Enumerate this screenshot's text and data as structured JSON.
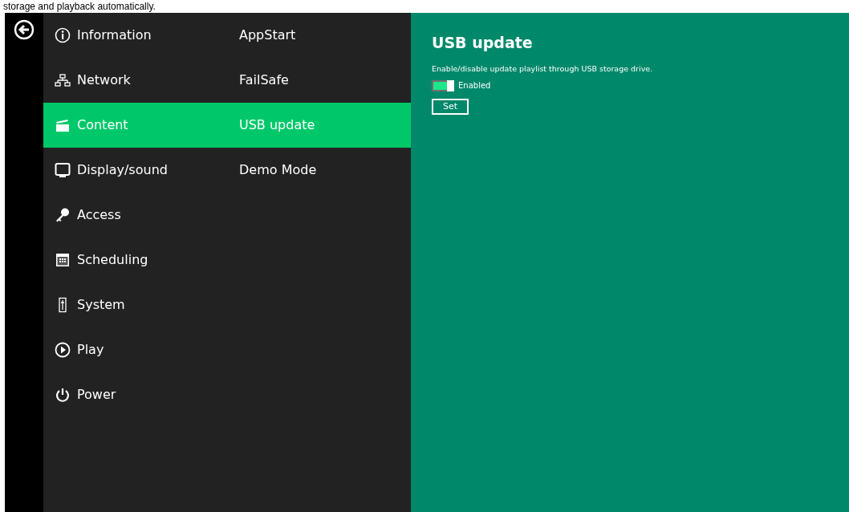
{
  "caption": "storage and playback automatically.",
  "categories": [
    {
      "label": "Information",
      "kind": "info",
      "selected": false
    },
    {
      "label": "Network",
      "kind": "network",
      "selected": false
    },
    {
      "label": "Content",
      "kind": "clapper",
      "selected": true
    },
    {
      "label": "Display/sound",
      "kind": "monitor",
      "selected": false
    },
    {
      "label": "Access",
      "kind": "key",
      "selected": false
    },
    {
      "label": "Scheduling",
      "kind": "calendar",
      "selected": false
    },
    {
      "label": "System",
      "kind": "fader",
      "selected": false
    },
    {
      "label": "Play",
      "kind": "play",
      "selected": false
    },
    {
      "label": "Power",
      "kind": "power",
      "selected": false
    }
  ],
  "subitems": [
    {
      "label": "AppStart",
      "selected": false
    },
    {
      "label": "FailSafe",
      "selected": false
    },
    {
      "label": "USB update",
      "selected": true
    },
    {
      "label": "Demo Mode",
      "selected": false
    }
  ],
  "panel": {
    "title": "USB update",
    "description": "Enable/disable update playlist through USB storage drive.",
    "toggle": {
      "label": "Enabled",
      "checked": true
    },
    "button": "Set"
  }
}
